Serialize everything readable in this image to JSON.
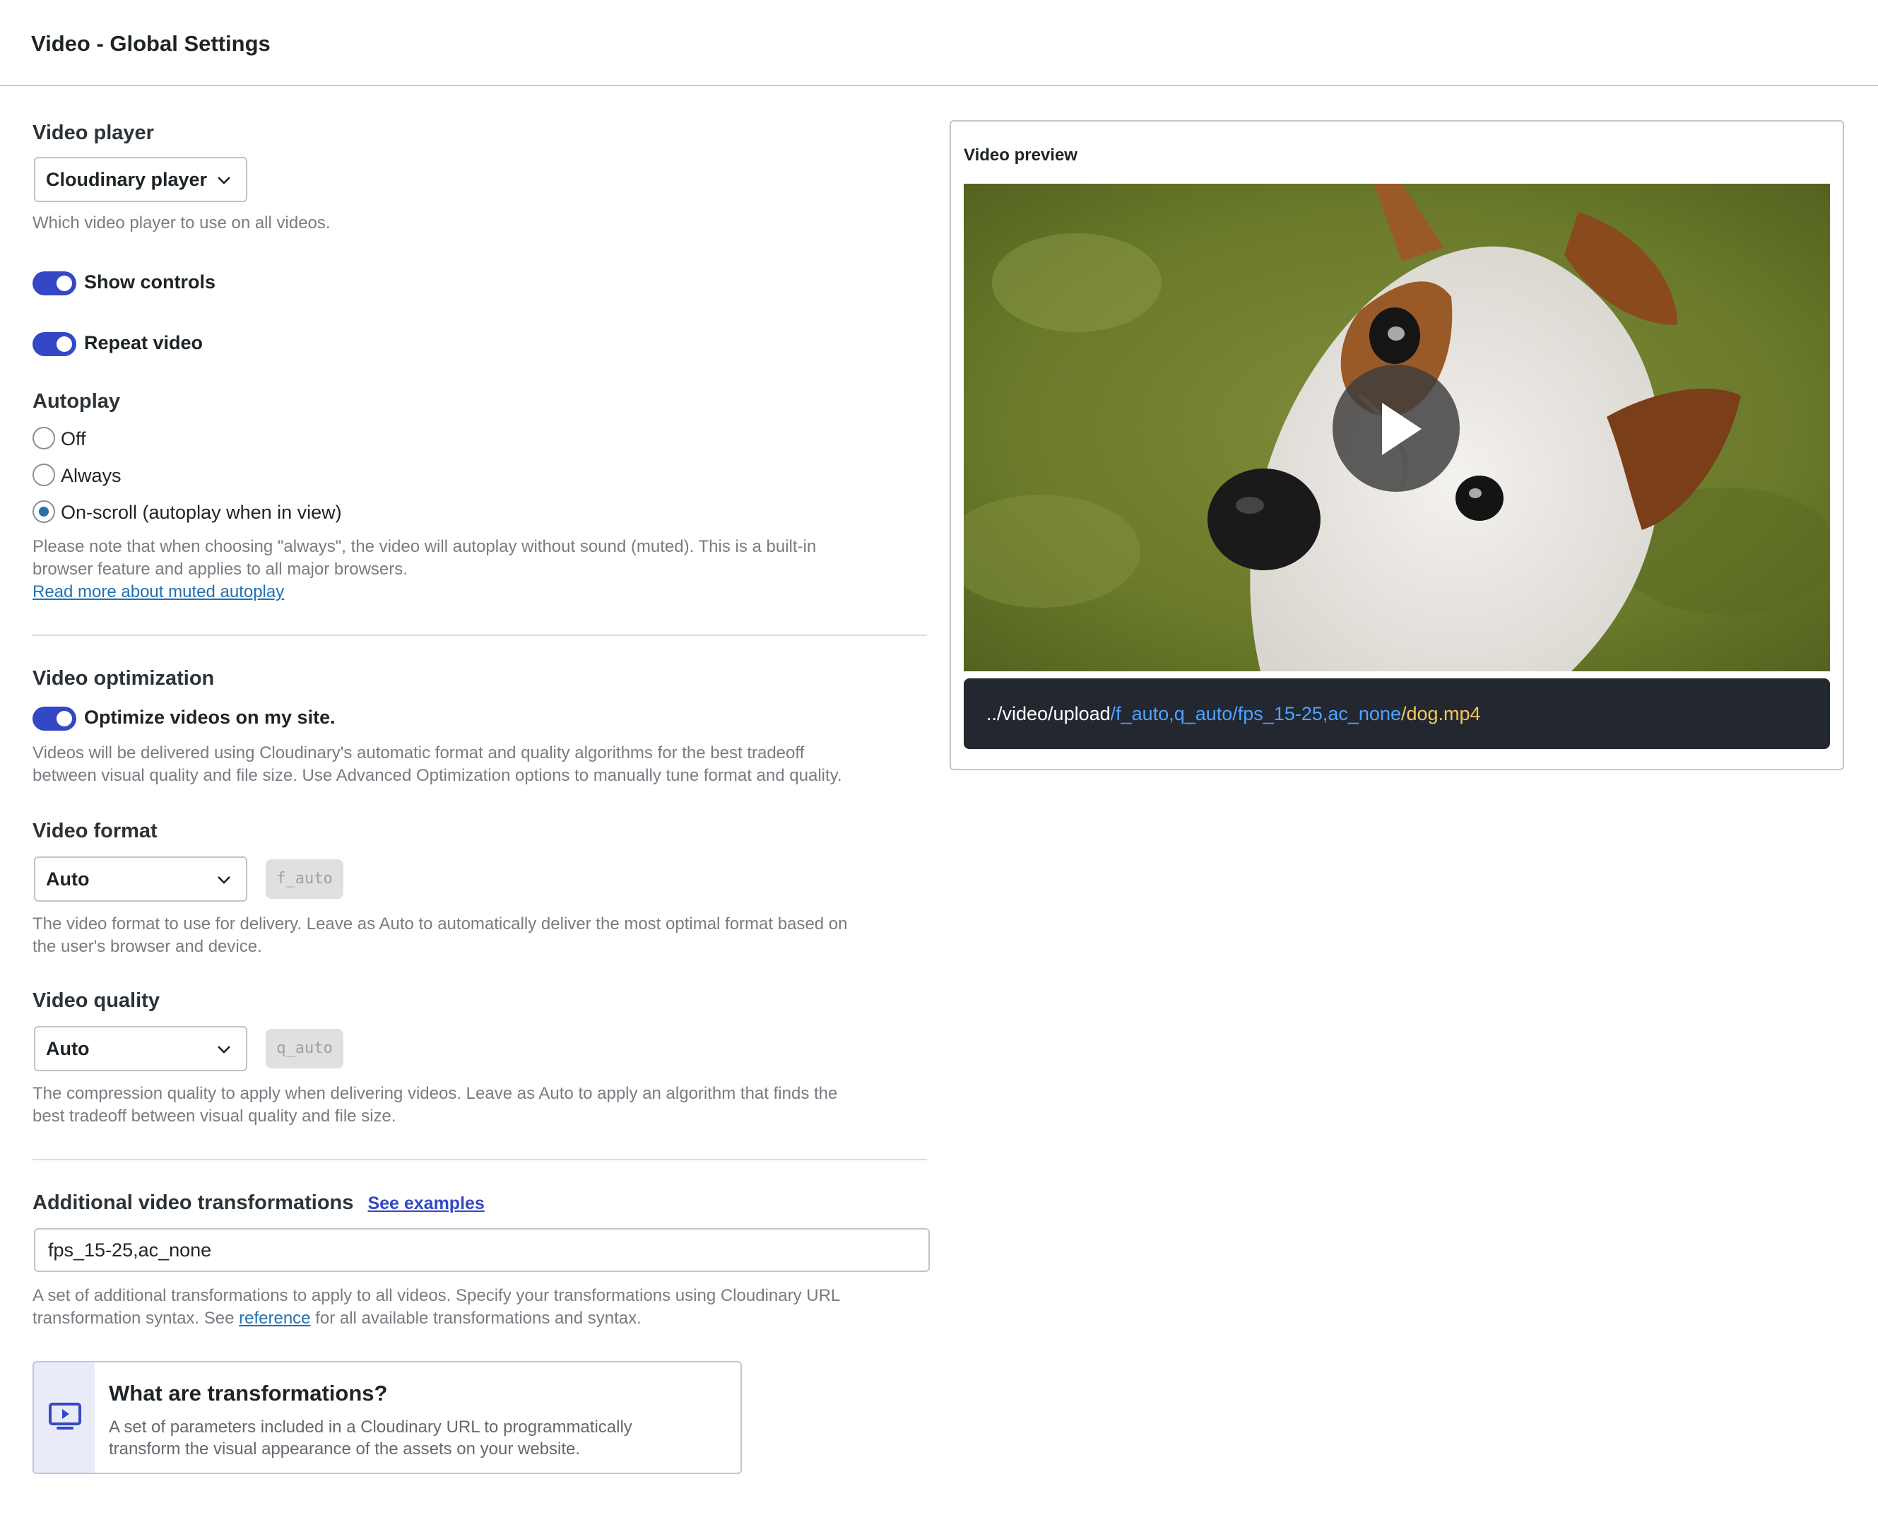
{
  "header": {
    "title": "Video - Global Settings"
  },
  "video_player": {
    "title": "Video player",
    "selected": "Cloudinary player",
    "help": "Which video player to use on all videos."
  },
  "toggles": {
    "show_controls": {
      "label": "Show controls",
      "on": true
    },
    "repeat_video": {
      "label": "Repeat video",
      "on": true
    }
  },
  "autoplay": {
    "title": "Autoplay",
    "options": [
      {
        "label": "Off",
        "checked": false
      },
      {
        "label": "Always",
        "checked": false
      },
      {
        "label": "On-scroll (autoplay when in view)",
        "checked": true
      }
    ],
    "note_line1": "Please note that when choosing \"always\", the video will autoplay without sound (muted). This is a built-in",
    "note_line2": "browser feature and applies to all major browsers.",
    "link": "Read more about muted autoplay"
  },
  "optimization": {
    "title": "Video optimization",
    "toggle_label": "Optimize videos on my site.",
    "toggle_on": true,
    "help_line1": "Videos will be delivered using Cloudinary's automatic format and quality algorithms for the best tradeoff",
    "help_line2": "between visual quality and file size. Use Advanced Optimization options to manually tune format and quality."
  },
  "format": {
    "title": "Video format",
    "selected": "Auto",
    "chip": "f_auto",
    "help_line1": "The video format to use for delivery. Leave as Auto to automatically deliver the most optimal format based on",
    "help_line2": "the user's browser and device."
  },
  "quality": {
    "title": "Video quality",
    "selected": "Auto",
    "chip": "q_auto",
    "help_line1": "The compression quality to apply when delivering videos. Leave as Auto to apply an algorithm that finds the",
    "help_line2": "best tradeoff between visual quality and file size."
  },
  "additional": {
    "title": "Additional video transformations",
    "examples_link": "See examples",
    "value": "fps_15-25,ac_none",
    "help_line1": "A set of additional transformations to apply to all videos. Specify your transformations using Cloudinary URL",
    "help_line2_pre": "transformation syntax. See ",
    "help_link": "reference",
    "help_line2_post": " for all available transformations and syntax."
  },
  "info": {
    "icon": "video-screen-icon",
    "title": "What are transformations?",
    "line1": "A set of parameters included in a Cloudinary URL to programmatically",
    "line2": "transform the visual appearance of the assets on your website."
  },
  "preview": {
    "title": "Video preview",
    "play_icon": "play-icon",
    "url_base": "../video/upload",
    "url_transform": "/f_auto,q_auto/fps_15-25,ac_none",
    "url_file": "/dog.mp4"
  },
  "colors": {
    "accent": "#3448c5",
    "link": "#2271b1",
    "url_transform": "#4da3ff",
    "url_file": "#f6c75a",
    "url_bar_bg": "#23272f"
  }
}
